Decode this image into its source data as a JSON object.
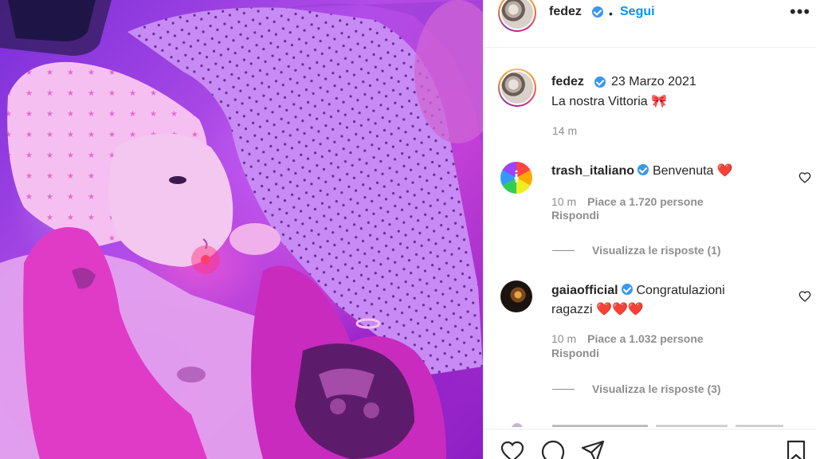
{
  "post": {
    "author": "fedez",
    "follow_label": "Segui",
    "follow_dot": "•",
    "more_icon": "more-options-icon"
  },
  "caption": {
    "author": "fedez",
    "date": "23 Marzo 2021",
    "text": "La nostra Vittoria 🎀",
    "time": "14 m"
  },
  "comments": [
    {
      "user": "trash_italiano",
      "text": "Benvenuta ❤️",
      "time": "10 m",
      "likes": "Piace a 1.720 persone",
      "reply": "Rispondi",
      "view_replies": "Visualizza le risposte (1)"
    },
    {
      "user": "gaiaofficial",
      "text_line1": "Congratulazioni",
      "text_line2": "ragazzi ❤️❤️❤️",
      "time": "10 m",
      "likes": "Piace a 1.032 persone",
      "reply": "Rispondi",
      "view_replies": "Visualizza le risposte (3)"
    }
  ],
  "actions": [
    "like-icon",
    "comment-icon",
    "share-icon",
    "save-icon"
  ],
  "colors": {
    "accent": "#0095f6",
    "verified": "#3897f0",
    "muted": "#8e8e8e",
    "text": "#262626",
    "heart": "#e0102a"
  }
}
